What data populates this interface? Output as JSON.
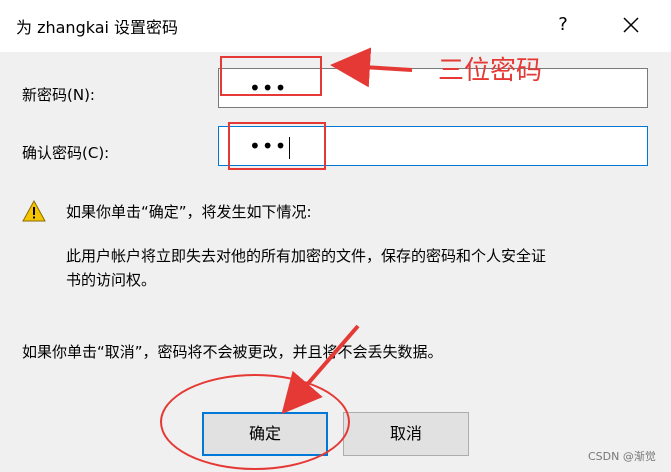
{
  "dialog": {
    "title": "为 zhangkai 设置密码",
    "help_label": "?",
    "new_password_label": "新密码(N):",
    "new_password_value": "•••",
    "confirm_password_label": "确认密码(C):",
    "confirm_password_value": "•••",
    "warning_heading": "如果你单击“确定”，将发生如下情况:",
    "warning_body_line1": "此用户帐户将立即失去对他的所有加密的文件，保存的密码和个人安全证",
    "warning_body_line2": "书的访问权。",
    "cancel_note": "如果你单击“取消”，密码将不会被更改，并且将不会丢失数据。",
    "ok_label": "确定",
    "cancel_label": "取消"
  },
  "annotations": {
    "callout_text": "三位密码",
    "color": "#e53935"
  },
  "watermark": "CSDN @渐觉",
  "colors": {
    "accent": "#0078d7",
    "content_bg": "#f0f0f0"
  },
  "icons": {
    "warning": "warning-icon",
    "close": "close-icon"
  }
}
